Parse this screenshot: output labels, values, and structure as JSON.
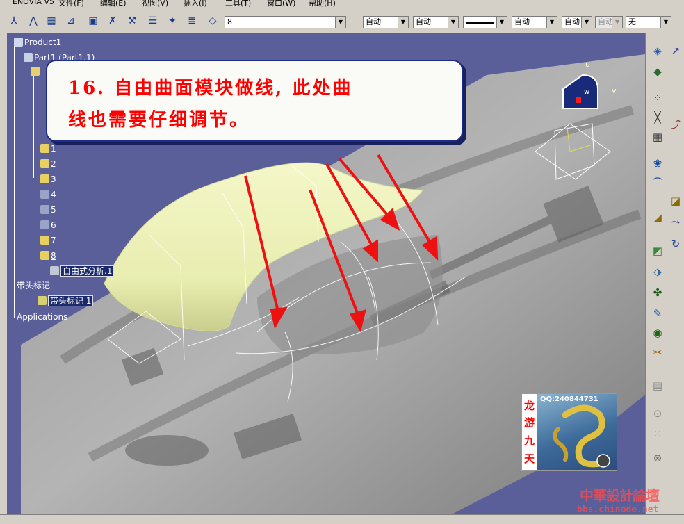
{
  "menu": {
    "items": [
      "ENOVIA V5",
      "文件(F)",
      "编辑(E)",
      "视图(V)",
      "插入(I)",
      "工具(T)",
      "窗口(W)",
      "帮助(H)"
    ]
  },
  "toolbar": {
    "layer_value": "8",
    "dropdowns": [
      "自动",
      "自动",
      "自动",
      "自动",
      "自动",
      "无"
    ]
  },
  "tree": {
    "root": "Product1",
    "part": "Part1 (Part1.1)",
    "items": [
      "1",
      "2",
      "3",
      "4",
      "5",
      "6",
      "7",
      "8"
    ],
    "analysis": "自由式分析.1",
    "annotations": "带头标记",
    "annotation_child": "带头标记 1",
    "applications": "Applications"
  },
  "callout": {
    "line1": "16. 自由曲面模块做线, 此处曲",
    "line2": "线也需要仔细调节。"
  },
  "compass": {
    "u": "u",
    "v": "v",
    "w": "w"
  },
  "logo": {
    "qq": "QQ:240844731",
    "chars": [
      "龙",
      "游",
      "九",
      "天"
    ]
  },
  "watermark": {
    "cn": "中華設計論壇",
    "url": "bbs.chinade.net"
  },
  "colors": {
    "viewport_bg": "#5a5f9a",
    "surface": "#eef2b8",
    "arrow": "#ee1111",
    "callout_text": "#ff0000",
    "callout_border": "#1c2a88"
  }
}
